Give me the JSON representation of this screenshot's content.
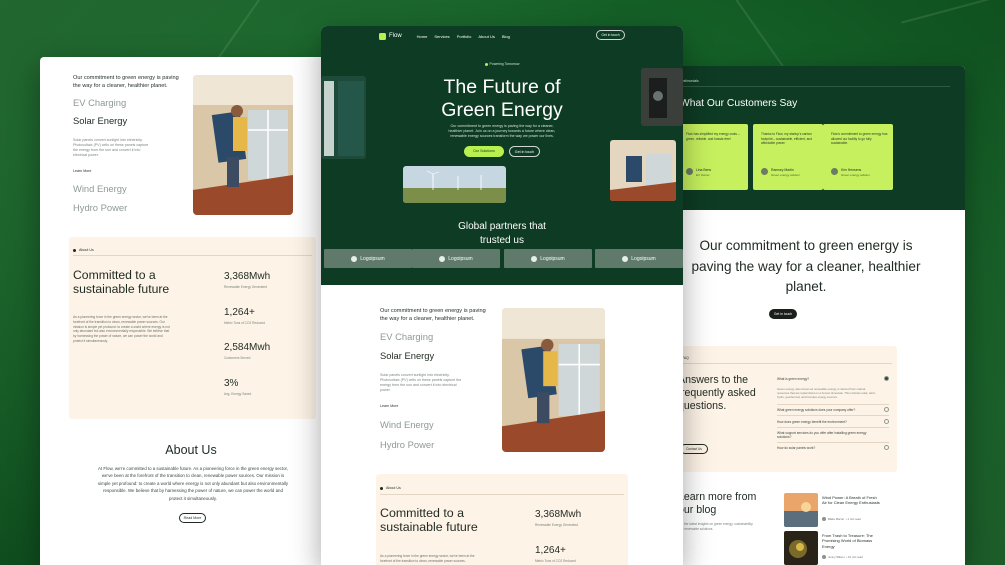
{
  "left_page": {
    "intro": "Our commitment to green energy is paving the way for a cleaner, healthier planet.",
    "services": [
      "EV Charging",
      "Solar Energy",
      "Wind Energy",
      "Hydro Power"
    ],
    "active_service": "Solar Energy",
    "service_desc": "Solar panels convert sunlight into electricity. Photovoltaic (PV) cells on these panels capture the energy from the sun and convert it into electrical power.",
    "learn_more": "Learn More",
    "stats": {
      "tag": "About Us",
      "heading": "Committed to a sustainable future",
      "paragraph": "As a pioneering force in the green energy sector, we've been at the forefront of the transition to clean, renewable power sources. Our mission is simple yet profound: to create a world where energy is not only abundant but also environmentally responsible. We believe that by harnessing the power of nature, we can power the world and protect it simultaneously.",
      "items": [
        {
          "value": "3,368Mwh",
          "label": "Renewable Energy Generated"
        },
        {
          "value": "1,264+",
          "label": "Metric Tons of CO2 Reduced"
        },
        {
          "value": "2,584Mwh",
          "label": "Customers Served"
        },
        {
          "value": "3%",
          "label": "Avg. Energy Saved"
        }
      ]
    },
    "about_title": "About Us",
    "about_text": "At Flow, we're committed to a sustainable future. As a pioneering force in the green energy sector, we've been at the forefront of the transition to clean, renewable power sources. Our mission is simple yet profound: to create a world where energy is not only abundant but also environmentally responsible. We believe that by harnessing the power of nature, we can power the world and protect it simultaneously.",
    "read_more": "Read More"
  },
  "center_page": {
    "brand": "Flow",
    "nav": [
      "Home",
      "Services",
      "Portfolio",
      "About Us",
      "Blog"
    ],
    "nav_cta": "Get in touch",
    "badge": "Powering Tomorrow",
    "title_line1": "The Future of",
    "title_line2": "Green Energy",
    "subtitle": "Our commitment to green energy is paving the way for a cleaner, healthier planet. Join us on a journey towards a future where clean, renewable energy sources transform the way we power our lives.",
    "btn_primary": "Our Solutions",
    "btn_secondary": "Get in touch",
    "partners_line1": "Global partners that",
    "partners_line2": "trusted us",
    "logos": [
      "Logoipsum",
      "Logoipsum",
      "Logoipsum",
      "Logoipsum"
    ],
    "intro": "Our commitment to green energy is paving the way for a cleaner, healthier planet.",
    "services": [
      "EV Charging",
      "Solar Energy",
      "Wind Energy",
      "Hydro Power"
    ],
    "active_service": "Solar Energy",
    "service_desc": "Solar panels convert sunlight into electricity. Photovoltaic (PV) cells on these panels capture the energy from the sun and convert it into electrical power.",
    "learn_more": "Learn More",
    "stats": {
      "tag": "About Us",
      "heading": "Committed to a sustainable future",
      "paragraph": "As a pioneering force in the green energy sector, we've been at the forefront of the transition to clean, renewable power sources.",
      "items": [
        {
          "value": "3,368Mwh",
          "label": "Renewable Energy Generated"
        },
        {
          "value": "1,264+",
          "label": "Metric Tons of CO2 Reduced"
        }
      ]
    }
  },
  "right_page": {
    "tag": "Testimonials",
    "customers_title": "What Our Customers Say",
    "testimonials": [
      {
        "quote": "Flow has simplified my energy costs – green, reliable, and hassle-free!",
        "name": "Lina Bens",
        "role": "EV Owner"
      },
      {
        "quote": "Thanks to Flow, my startup's carbon footprint – sustainable, efficient, and affordable power.",
        "name": "Ramsey Martin",
        "role": "Green energy advisor"
      },
      {
        "quote": "Flow's commitment to green energy has allowed our facility to go fully sustainable.",
        "name": "Kim Hensens",
        "role": "Green energy advisor"
      }
    ],
    "commit_text": "Our commitment to green energy is paving the way for a cleaner, healthier planet.",
    "start_btn": "Get in touch",
    "faq": {
      "tag": "FAQ",
      "title": "Answers to the frequently asked questions.",
      "contact": "Contact Us",
      "questions": [
        "What is green energy?",
        "What green energy solutions does your company offer?",
        "How does green energy benefit the environment?",
        "What support services do you offer after installing green energy solutions?",
        "How do solar panels work?"
      ],
      "answer": "Green energy, also known as renewable energy, is derived from natural resources that are replenished on a human timescale. This includes solar, wind, hydro, geothermal, and biomass energy sources."
    },
    "blog_title": "Learn more from our blog",
    "blog_desc": "Get the latest insights on green energy, sustainability, and renewable solutions.",
    "posts": [
      {
        "title": "Wind Power: A Breath of Fresh Air for Clean Energy Enthusiasts",
        "author": "Blake Marvin",
        "time": "1 min read"
      },
      {
        "title": "From Trash to Treasure: The Promising World of Biomass Energy",
        "author": "Jenny Wilson",
        "time": "10 min read"
      }
    ]
  },
  "colors": {
    "dark_green": "#0e3b23",
    "lime": "#b8f04f",
    "cream": "#fdf3e7",
    "background": "#156128"
  }
}
